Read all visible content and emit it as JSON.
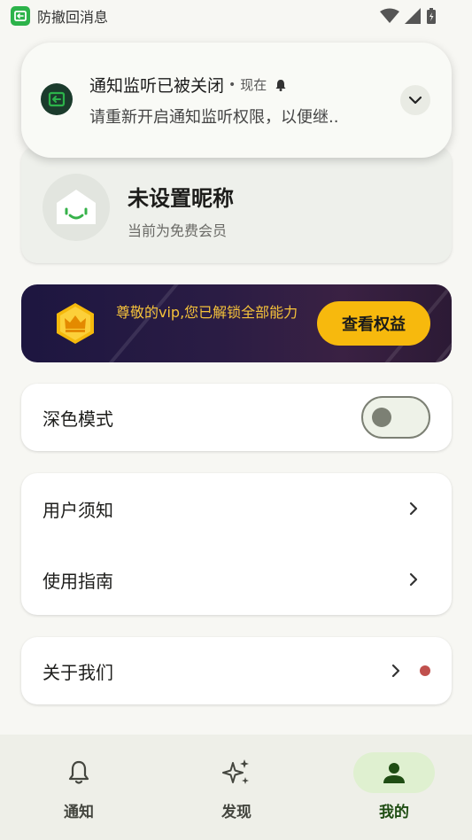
{
  "status_bar": {
    "app_name": "防撤回消息",
    "app_icon": "recall-app-icon",
    "icons": [
      "wifi-icon",
      "signal-icon",
      "battery-icon"
    ]
  },
  "notification": {
    "title": "通知监听已被关闭",
    "separator": "•",
    "time": "现在",
    "body": "请重新开启通知监听权限，以便继..",
    "icons": [
      "app-icon",
      "bell-icon",
      "chevron-down-icon"
    ]
  },
  "profile": {
    "name": "未设置昵称",
    "membership": "当前为免费会员"
  },
  "vip": {
    "text": "尊敬的vip,您已解锁全部能力",
    "button_label": "查看权益",
    "icon": "crown-icon",
    "accent": "#f7b90d"
  },
  "settings": {
    "dark_mode_label": "深色模式",
    "dark_mode_on": false
  },
  "links": {
    "user_notice": "用户须知",
    "guide": "使用指南",
    "about": "关于我们"
  },
  "bottom_nav": {
    "items": [
      {
        "label": "通知",
        "icon": "bell-icon",
        "active": false
      },
      {
        "label": "发现",
        "icon": "sparkle-icon",
        "active": false
      },
      {
        "label": "我的",
        "icon": "person-icon",
        "active": true
      }
    ]
  }
}
